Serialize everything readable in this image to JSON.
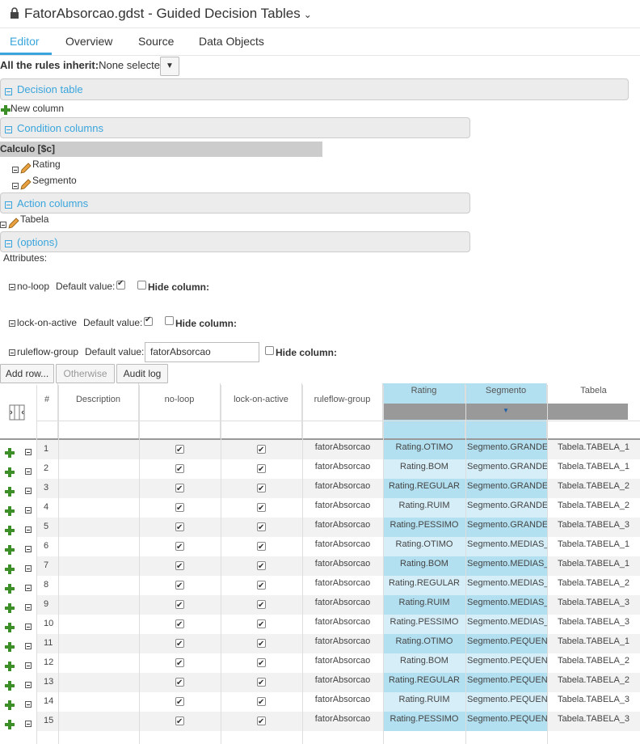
{
  "header": {
    "title": "FatorAbsorcao.gdst - Guided Decision Tables"
  },
  "tabs": [
    {
      "label": "Editor"
    },
    {
      "label": "Overview"
    },
    {
      "label": "Source"
    },
    {
      "label": "Data Objects"
    }
  ],
  "inherit": {
    "label": "All the rules inherit:",
    "value": "None selected"
  },
  "sections": {
    "decision_table": "Decision table",
    "new_column": "New column",
    "condition_columns": "Condition columns",
    "action_columns": "Action columns",
    "options": "(options)"
  },
  "condition_group": {
    "label": "Calculo [$c]",
    "items": [
      "Rating",
      "Segmento"
    ]
  },
  "action_items": [
    "Tabela"
  ],
  "attributes": {
    "label": "Attributes:",
    "default_label": "Default value:",
    "hide_label": "Hide column:",
    "items": [
      {
        "name": "no-loop",
        "default_checked": true
      },
      {
        "name": "lock-on-active",
        "default_checked": true
      },
      {
        "name": "ruleflow-group",
        "default_value": "fatorAbsorcao"
      }
    ]
  },
  "buttons": {
    "add_row": "Add row...",
    "otherwise": "Otherwise",
    "audit_log": "Audit log"
  },
  "grid": {
    "columns": [
      "#",
      "Description",
      "no-loop",
      "lock-on-active",
      "ruleflow-group",
      "Rating",
      "Segmento",
      "Tabela"
    ],
    "rows": [
      {
        "num": "1",
        "ruleflow": "fatorAbsorcao",
        "rating": "Rating.OTIMO",
        "segmento": "Segmento.GRANDES",
        "tabela": "Tabela.TABELA_1"
      },
      {
        "num": "2",
        "ruleflow": "fatorAbsorcao",
        "rating": "Rating.BOM",
        "segmento": "Segmento.GRANDES",
        "tabela": "Tabela.TABELA_1"
      },
      {
        "num": "3",
        "ruleflow": "fatorAbsorcao",
        "rating": "Rating.REGULAR",
        "segmento": "Segmento.GRANDES",
        "tabela": "Tabela.TABELA_2"
      },
      {
        "num": "4",
        "ruleflow": "fatorAbsorcao",
        "rating": "Rating.RUIM",
        "segmento": "Segmento.GRANDES",
        "tabela": "Tabela.TABELA_2"
      },
      {
        "num": "5",
        "ruleflow": "fatorAbsorcao",
        "rating": "Rating.PESSIMO",
        "segmento": "Segmento.GRANDES",
        "tabela": "Tabela.TABELA_3"
      },
      {
        "num": "6",
        "ruleflow": "fatorAbsorcao",
        "rating": "Rating.OTIMO",
        "segmento": "Segmento.MEDIAS_E",
        "tabela": "Tabela.TABELA_1"
      },
      {
        "num": "7",
        "ruleflow": "fatorAbsorcao",
        "rating": "Rating.BOM",
        "segmento": "Segmento.MEDIAS_E",
        "tabela": "Tabela.TABELA_1"
      },
      {
        "num": "8",
        "ruleflow": "fatorAbsorcao",
        "rating": "Rating.REGULAR",
        "segmento": "Segmento.MEDIAS_E",
        "tabela": "Tabela.TABELA_2"
      },
      {
        "num": "9",
        "ruleflow": "fatorAbsorcao",
        "rating": "Rating.RUIM",
        "segmento": "Segmento.MEDIAS_E",
        "tabela": "Tabela.TABELA_3"
      },
      {
        "num": "10",
        "ruleflow": "fatorAbsorcao",
        "rating": "Rating.PESSIMO",
        "segmento": "Segmento.MEDIAS_E",
        "tabela": "Tabela.TABELA_3"
      },
      {
        "num": "11",
        "ruleflow": "fatorAbsorcao",
        "rating": "Rating.OTIMO",
        "segmento": "Segmento.PEQUENA",
        "tabela": "Tabela.TABELA_1"
      },
      {
        "num": "12",
        "ruleflow": "fatorAbsorcao",
        "rating": "Rating.BOM",
        "segmento": "Segmento.PEQUENA",
        "tabela": "Tabela.TABELA_2"
      },
      {
        "num": "13",
        "ruleflow": "fatorAbsorcao",
        "rating": "Rating.REGULAR",
        "segmento": "Segmento.PEQUENA",
        "tabela": "Tabela.TABELA_2"
      },
      {
        "num": "14",
        "ruleflow": "fatorAbsorcao",
        "rating": "Rating.RUIM",
        "segmento": "Segmento.PEQUENA",
        "tabela": "Tabela.TABELA_3"
      },
      {
        "num": "15",
        "ruleflow": "fatorAbsorcao",
        "rating": "Rating.PESSIMO",
        "segmento": "Segmento.PEQUENA",
        "tabela": "Tabela.TABELA_3"
      }
    ]
  },
  "colors": {
    "accent": "#39a5dc",
    "condition_bg": "#b3e0f0",
    "row_alt": "#f2f2f2",
    "add_green": "#3c8f26"
  }
}
